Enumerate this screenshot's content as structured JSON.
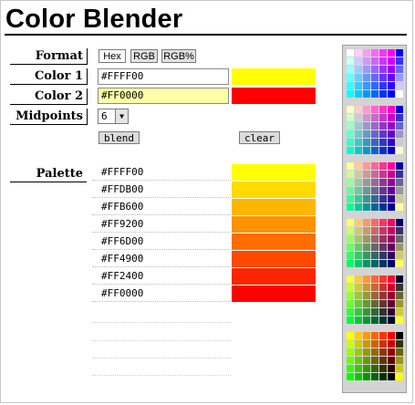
{
  "app": {
    "title": "Color Blender"
  },
  "format": {
    "label": "Format",
    "options": [
      "Hex",
      "RGB",
      "RGB%"
    ],
    "selected": "Hex"
  },
  "color1": {
    "label": "Color 1",
    "value": "#FFFF00",
    "swatch": "#FFFF00"
  },
  "color2": {
    "label": "Color 2",
    "value": "#FF0000",
    "swatch": "#FF0000",
    "field_bg": "#FFFFA8"
  },
  "midpoints": {
    "label": "Midpoints",
    "value": "6"
  },
  "actions": {
    "blend_label": "blend",
    "clear_label": "clear"
  },
  "palette": {
    "label": "Palette",
    "colors": [
      "#FFFF00",
      "#FFDB00",
      "#FFB600",
      "#FF9200",
      "#FF6D00",
      "#FF4900",
      "#FF2400",
      "#FF0000"
    ]
  }
}
